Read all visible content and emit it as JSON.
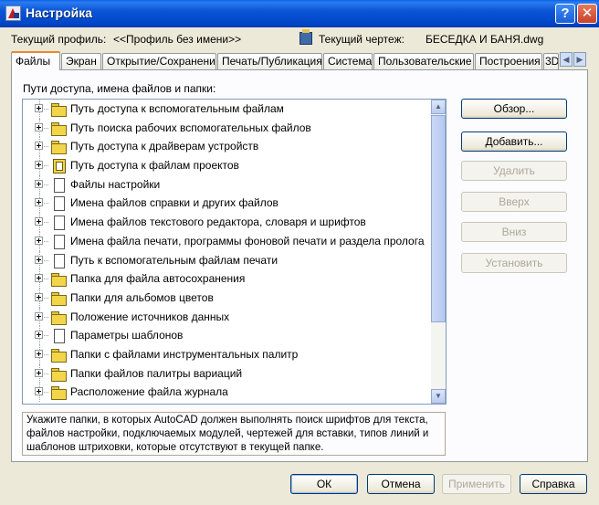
{
  "window": {
    "title": "Настройка"
  },
  "profile": {
    "profile_label": "Текущий профиль:",
    "profile_value": "<<Профиль без имени>>",
    "drawing_label": "Текущий чертеж:",
    "drawing_value": "БЕСЕДКА И БАНЯ.dwg"
  },
  "tabs": [
    {
      "label": "Файлы",
      "active": true
    },
    {
      "label": "Экран"
    },
    {
      "label": "Открытие/Сохранение"
    },
    {
      "label": "Печать/Публикация"
    },
    {
      "label": "Система"
    },
    {
      "label": "Пользовательские"
    },
    {
      "label": "Построения"
    },
    {
      "label": "3D"
    }
  ],
  "panel": {
    "caption": "Пути доступа, имена файлов и папки:",
    "items": [
      {
        "label": "Путь доступа к вспомогательным файлам",
        "icon": "folder-icon"
      },
      {
        "label": "Путь поиска рабочих вспомогательных файлов",
        "icon": "folder-icon"
      },
      {
        "label": "Путь доступа к драйверам устройств",
        "icon": "folder-icon"
      },
      {
        "label": "Путь доступа к файлам проектов",
        "icon": "project-icon"
      },
      {
        "label": "Файлы настройки",
        "icon": "page-icon"
      },
      {
        "label": "Имена файлов справки и других файлов",
        "icon": "page-icon"
      },
      {
        "label": "Имена файлов текстового редактора, словаря и шрифтов",
        "icon": "page-icon"
      },
      {
        "label": "Имена файла печати, программы фоновой печати и раздела пролога",
        "icon": "page-icon"
      },
      {
        "label": "Путь к вспомогательным файлам печати",
        "icon": "page-icon"
      },
      {
        "label": "Папка для файла автосохранения",
        "icon": "folder-icon"
      },
      {
        "label": "Папки для альбомов цветов",
        "icon": "folder-icon"
      },
      {
        "label": "Положение источников данных",
        "icon": "folder-icon"
      },
      {
        "label": "Параметры шаблонов",
        "icon": "page-icon"
      },
      {
        "label": "Папки с файлами инструментальных палитр",
        "icon": "folder-icon"
      },
      {
        "label": "Папки файлов палитры вариаций",
        "icon": "folder-icon"
      },
      {
        "label": "Расположение файла журнала",
        "icon": "folder-icon"
      }
    ],
    "description": "Укажите папки, в которых AutoCAD должен выполнять поиск шрифтов для текста, файлов настройки, подключаемых модулей, чертежей для вставки, типов линий и шаблонов штриховки, которые отсутствуют в текущей папке.",
    "buttons": {
      "browse": "Обзор...",
      "add": "Добавить...",
      "remove": "Удалить",
      "up": "Вверх",
      "down": "Вниз",
      "set_current": "Установить"
    }
  },
  "footer": {
    "ok": "ОК",
    "cancel": "Отмена",
    "apply": "Применить",
    "help": "Справка"
  },
  "colors": {
    "titlebar": "#0045c8",
    "dialog_bg": "#ece9d8",
    "active_tab_accent": "#e68b2c"
  }
}
